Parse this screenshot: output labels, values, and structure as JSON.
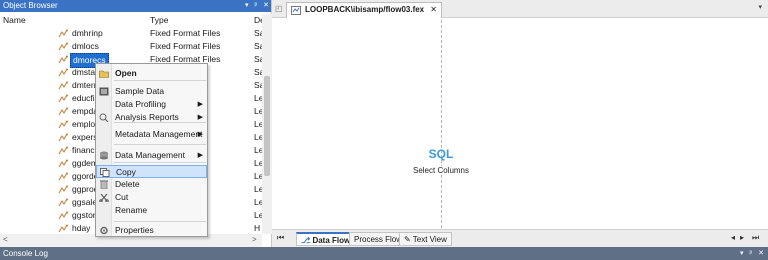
{
  "object_browser": {
    "title": "Object Browser",
    "title_buttons": [
      "▾",
      "ᵖ",
      "✕"
    ],
    "columns": {
      "name": "Name",
      "type": "Type",
      "desc": "Desci"
    },
    "rows": [
      {
        "name": "dmhrinp",
        "type": "Fixed Format Files",
        "desc": "Sa"
      },
      {
        "name": "dmlocs",
        "type": "Fixed Format Files",
        "desc": "Sa"
      },
      {
        "name": "dmorecs",
        "type": "Fixed Format Files",
        "desc": "Sa"
      },
      {
        "name": "dmstart",
        "type": "",
        "desc": "Sa"
      },
      {
        "name": "dmterm",
        "type": "",
        "desc": "Sa"
      },
      {
        "name": "educfile",
        "type": "",
        "desc": "Le"
      },
      {
        "name": "empdat",
        "type": "",
        "desc": "Le"
      },
      {
        "name": "employ",
        "type": "",
        "desc": "Le"
      },
      {
        "name": "experso",
        "type": "",
        "desc": "Le"
      },
      {
        "name": "finance",
        "type": "",
        "desc": "Le"
      },
      {
        "name": "ggdemo",
        "type": "",
        "desc": "Le"
      },
      {
        "name": "ggorder",
        "type": "",
        "desc": "Le"
      },
      {
        "name": "ggprod",
        "type": "",
        "desc": "Le"
      },
      {
        "name": "ggsales",
        "type": "",
        "desc": "Le"
      },
      {
        "name": "ggstore",
        "type": "",
        "desc": "Le"
      },
      {
        "name": "hday",
        "type": "",
        "desc": "H ▾"
      }
    ],
    "selected_row": "dmorecs",
    "hscroll_left": "<",
    "hscroll_right": ">"
  },
  "context_menu": {
    "items": [
      {
        "label": "Open",
        "bold": true,
        "icon": "open-folder-icon",
        "submenu": false
      },
      {
        "label": "Sample Data",
        "bold": false,
        "icon": "sample-data-icon",
        "submenu": false
      },
      {
        "label": "Data Profiling",
        "bold": false,
        "icon": "",
        "submenu": true
      },
      {
        "label": "Analysis Reports",
        "bold": false,
        "icon": "analysis-icon",
        "submenu": true
      },
      {
        "label": "Metadata Management",
        "bold": false,
        "icon": "",
        "submenu": true
      },
      {
        "label": "Data Management",
        "bold": false,
        "icon": "data-management-icon",
        "submenu": true
      },
      {
        "label": "Copy",
        "bold": false,
        "icon": "copy-icon",
        "submenu": false
      },
      {
        "label": "Delete",
        "bold": false,
        "icon": "delete-icon",
        "submenu": false
      },
      {
        "label": "Cut",
        "bold": false,
        "icon": "cut-icon",
        "submenu": false
      },
      {
        "label": "Rename",
        "bold": false,
        "icon": "",
        "submenu": false
      },
      {
        "label": "Properties",
        "bold": false,
        "icon": "properties-icon",
        "submenu": false
      }
    ],
    "highlighted": "Copy",
    "submenu_glyph": "▶"
  },
  "editor": {
    "doc_tab": "LOOPBACK\\ibisamp/flow03.fex",
    "doc_tab_close": "✕",
    "canvas": {
      "sql_title": "SQL",
      "sql_subtitle": "Select Columns"
    },
    "bottom_tabs": [
      {
        "label": "Data Flow",
        "active": true
      },
      {
        "label": "Process Flow",
        "active": false
      },
      {
        "label": "Text View",
        "active": false
      }
    ]
  },
  "console": {
    "title": "Console Log",
    "buttons": [
      "▾",
      "ᵖ",
      "✕"
    ]
  },
  "colors": {
    "title_bar": "#3a73c4",
    "selection": "#1f6fd1",
    "menu_highlight": "#cfe3fb",
    "sql_accent": "#3a9ad9",
    "console_bar": "#5f6f86"
  }
}
